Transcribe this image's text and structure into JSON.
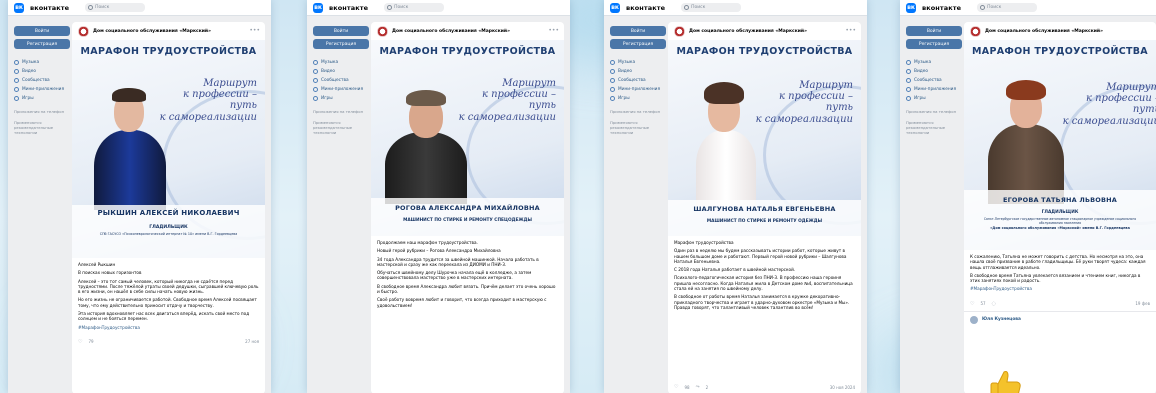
{
  "vk": {
    "brand": "вконтакте",
    "logo": "вк",
    "search_placeholder": "Поиск",
    "login": "Войти",
    "register": "Регистрация",
    "menu": [
      "Музыка",
      "Видео",
      "Сообщества",
      "Мини-приложения",
      "Игры"
    ],
    "apps_note": "Приложения на телефон",
    "privacy_note": "Применяются рекомендательные технологии"
  },
  "org": "Дом социального обслуживания «Маркский»",
  "banner": {
    "title": "МАРАФОН ТРУДОУСТРОЙСТВА",
    "slogan_1": "Маршрут",
    "slogan_2": "к профессии –",
    "slogan_3": "путь",
    "slogan_4": "к самореализации"
  },
  "posts": [
    {
      "name": "РЫКШИН АЛЕКСЕЙ НИКОЛАЕВИЧ",
      "position": "ГЛАДИЛЬЩИК",
      "extra": "СПб ГАСУСО «Психоневрологический интернат № 10» имени В.Г. Гордеевцева",
      "text_1": "Алексей Рыкшин",
      "text_2": "В поисках новых горизонтов",
      "text_3": "Алексей – это тот самый человек, который никогда не сдаётся перед трудностями. После тяжёлой утраты своей дедушки, сыгравшей ключевую роль в его жизни, он нашёл в себе силы начать новую жизнь.",
      "text_4": "Но его жизнь не ограничивается работой. Свободное время Алексей посвящает тому, что ему действительно приносит отдачу и творчеству.",
      "text_5": "Эта история вдохновляет нас всех двигаться вперёд, искать свой место под солнцем и не бояться перемен.",
      "hashtag": "#МарафонТрудоустройства",
      "likes": "79",
      "time": "27 ноя"
    },
    {
      "name": "РОГОВА АЛЕКСАНДРА МИХАЙЛОВНА",
      "position": "МАШИНИСТ ПО СТИРКЕ И РЕМОНТУ СПЕЦОДЕЖДЫ",
      "text_1": "Продолжаем наш марафон трудоустройства.",
      "text_2": "Новый герой рубрики – Рогова Александра Михайловна",
      "text_3": "34 года Александра трудится за швейной машинкой. Начала работать в мастерской и сразу же как переехала из ДИОМИ и ПНИ-3.",
      "text_4": "Обучаться швейному делу Шурочка начала ещё в колледже, а затем совершенствовала мастерство уже в мастерских интерната.",
      "text_5": "В свободное время Александра любит вязать. Причём делает это очень хорошо и быстро.",
      "text_6": "Своё работу вовремя любит и говорит, что всегда приходит в мастерскую с удовольствием!"
    },
    {
      "name": "ШАЛГУНОВА НАТАЛЬЯ ЕВГЕНЬЕВНА",
      "position": "МАШИНИСТ ПО СТИРКЕ И РЕМОНТУ ОДЕЖДЫ",
      "text_1": "Марафон трудоустройства",
      "text_2": "Один раз в неделю мы будем рассказывать истории работ, которые живут в нашем большом доме и работают. Первый герой новой рубрики – Шалгунова Наталья Евгеньевна.",
      "text_3": "С 2018 года Наталья работает в швейной мастерской.",
      "text_4": "Психолого-педагогическая история без ПНИ-3. В профессию наша героиня пришла несогласно. Когда Наталья жила в Детском доме №4, воспитательница стала ей на занятия по швейному делу.",
      "text_5": "В свободное от работы время Наталья занимается в кружке декоративно-прикладного творчества и играет в ударно-духовом оркестре «Музыка и Мы». Правда говорят, что талантливый человек талантлив во всём!",
      "likes": "98",
      "reposts": "2",
      "time": "30 ноя 2024"
    },
    {
      "name": "ЕГОРОВА ТАТЬЯНА ЛЬВОВНА",
      "position": "ГЛАДИЛЬЩИК",
      "extra_1": "Санкт-Петербургское государственное автономное стационарное учреждение социального обслуживания населения",
      "extra_2": "«Дом социального обслуживания «Маркский» имени В.Г. Гордеевцева",
      "text_1": "К сожалению, Татьяна не может говорить с детства. Но несмотря на это, она нашла своё призвание в работе гладильщицы. Её руки творят чудеса: каждая вещь отглаживается идеально.",
      "text_2": "В свободное время Татьяна увлекается вязанием и чтением книг, никогда в этих занятиях покой и радость.",
      "hashtag": "#МарафонТрудоустройства",
      "likes": "57",
      "time": "19 фев",
      "commenter": "Юля Кузнецова"
    }
  ],
  "colors": {
    "vk_blue": "#0077ff",
    "button_blue": "#4a76a8",
    "banner_title": "#1f3f72",
    "slogan": "#3a4c8f"
  }
}
